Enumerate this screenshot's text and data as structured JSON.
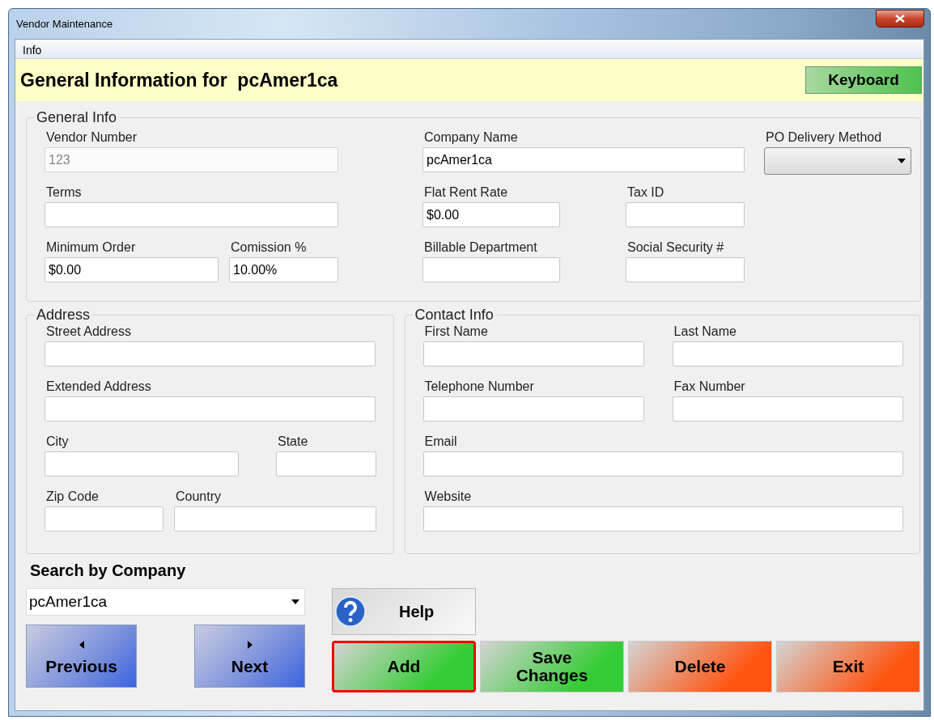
{
  "window": {
    "title": "Vendor Maintenance"
  },
  "menu": [
    {
      "label": "Info"
    }
  ],
  "header": {
    "title": "General Information for  pcAmer1ca",
    "keyboard_button": "Keyboard"
  },
  "sections": [
    {
      "title": "General Info",
      "fields": [
        {
          "label": "Vendor Number",
          "value": "123",
          "disabled": true,
          "kind": "text"
        },
        {
          "label": "Company Name",
          "value": "pcAmer1ca",
          "disabled": false,
          "kind": "text"
        },
        {
          "label": "PO Delivery Method",
          "disabled": false,
          "kind": "select"
        },
        {
          "label": "Terms",
          "disabled": false,
          "kind": "text"
        },
        {
          "label": "Flat Rent Rate",
          "value": "$0.00",
          "disabled": false,
          "kind": "text"
        },
        {
          "label": "Tax ID",
          "disabled": false,
          "kind": "text"
        },
        {
          "label": "Minimum Order",
          "value": "$0.00",
          "disabled": false,
          "kind": "text"
        },
        {
          "label": "Comission %",
          "value": "10.00%",
          "disabled": false,
          "kind": "text"
        },
        {
          "label": "Billable Department",
          "disabled": false,
          "kind": "text"
        },
        {
          "label": "Social Security #",
          "disabled": false,
          "kind": "text"
        }
      ]
    },
    {
      "title": "Address",
      "fields": [
        {
          "label": "Street Address",
          "disabled": false,
          "kind": "text"
        },
        {
          "label": "Extended Address",
          "disabled": false,
          "kind": "text"
        },
        {
          "label": "City",
          "disabled": false,
          "kind": "text"
        },
        {
          "label": "State",
          "disabled": false,
          "kind": "text"
        },
        {
          "label": "Zip Code",
          "disabled": false,
          "kind": "text"
        },
        {
          "label": "Country",
          "disabled": false,
          "kind": "text"
        }
      ]
    },
    {
      "title": "Contact Info",
      "fields": [
        {
          "label": "First Name",
          "disabled": false,
          "kind": "text"
        },
        {
          "label": "Last Name",
          "disabled": false,
          "kind": "text"
        },
        {
          "label": "Telephone Number",
          "disabled": false,
          "kind": "text"
        },
        {
          "label": "Fax Number",
          "disabled": false,
          "kind": "text"
        },
        {
          "label": "Email",
          "disabled": false,
          "kind": "text"
        },
        {
          "label": "Website",
          "disabled": false,
          "kind": "text"
        }
      ]
    }
  ],
  "search": {
    "label": "Search by Company",
    "value": "pcAmer1ca"
  },
  "nav_buttons": [
    {
      "label": "Previous",
      "kind": "prev"
    },
    {
      "label": "Next",
      "kind": "next"
    }
  ],
  "help_button": {
    "label": "Help"
  },
  "action_buttons": [
    {
      "label": "Add",
      "color": "#33cc33",
      "focused": true
    },
    {
      "label": "Save Changes",
      "color": "#33cc33",
      "focused": false
    },
    {
      "label": "Delete",
      "color": "#ff5511",
      "focused": false
    },
    {
      "label": "Exit",
      "color": "#ff5511",
      "focused": false
    }
  ]
}
